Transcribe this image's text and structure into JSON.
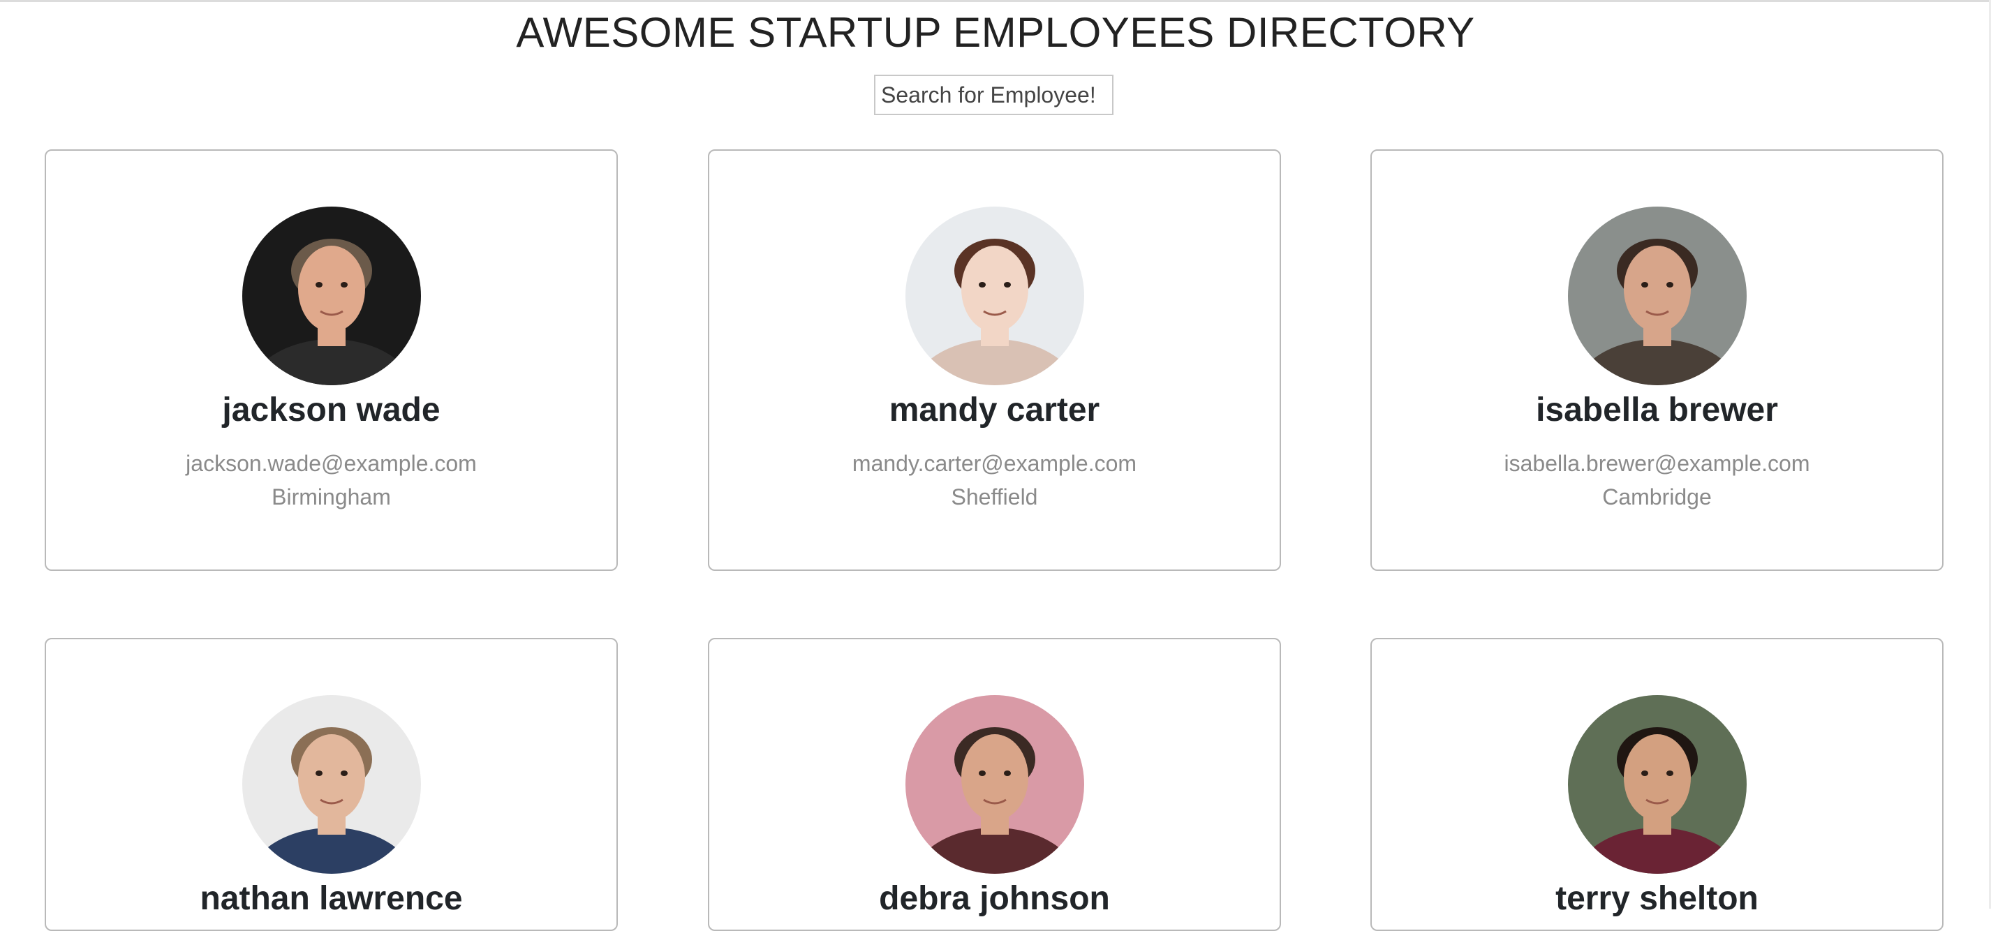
{
  "header": {
    "title": "AWESOME STARTUP EMPLOYEES DIRECTORY"
  },
  "search": {
    "placeholder": "Search for Employee!"
  },
  "employees": [
    {
      "name": "jackson wade",
      "email": "jackson.wade@example.com",
      "city": "Birmingham",
      "avatar_bg": "#1a1a1a",
      "skin": "#e0a98c",
      "hair": "#6b5a4a",
      "shirt": "#2b2b2b"
    },
    {
      "name": "mandy carter",
      "email": "mandy.carter@example.com",
      "city": "Sheffield",
      "avatar_bg": "#e8ebee",
      "skin": "#f2d6c6",
      "hair": "#5a3325",
      "shirt": "#d9c1b4"
    },
    {
      "name": "isabella brewer",
      "email": "isabella.brewer@example.com",
      "city": "Cambridge",
      "avatar_bg": "#8a8f8c",
      "skin": "#d7a58a",
      "hair": "#3a2a22",
      "shirt": "#4a4038"
    },
    {
      "name": "nathan lawrence",
      "email": "",
      "city": "",
      "avatar_bg": "#eaeaea",
      "skin": "#e2b79c",
      "hair": "#8b6f55",
      "shirt": "#2c3f63"
    },
    {
      "name": "debra johnson",
      "email": "",
      "city": "",
      "avatar_bg": "#d99aa6",
      "skin": "#d9a589",
      "hair": "#3b2a24",
      "shirt": "#5a2a2e"
    },
    {
      "name": "terry shelton",
      "email": "",
      "city": "",
      "avatar_bg": "#5f6f56",
      "skin": "#d3a080",
      "hair": "#1f1612",
      "shirt": "#6a2334"
    }
  ]
}
